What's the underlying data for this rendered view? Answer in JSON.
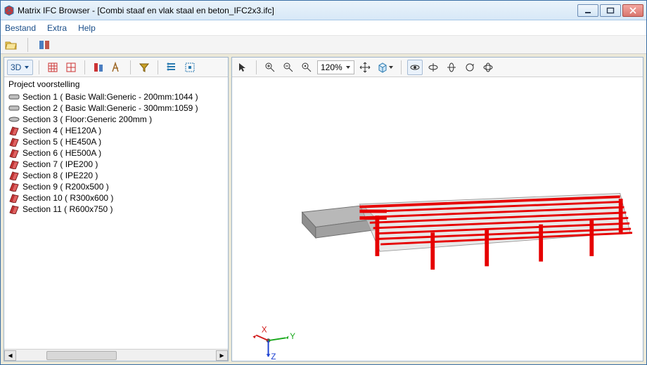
{
  "window": {
    "title": "Matrix IFC Browser - [Combi staaf en vlak staal en beton_IFC2x3.ifc]"
  },
  "menubar": {
    "items": [
      "Bestand",
      "Extra",
      "Help"
    ]
  },
  "left": {
    "view_mode": "3D",
    "tree_header": "Project voorstelling",
    "items": [
      {
        "type": "wall",
        "label": "Section 1 ( Basic Wall:Generic - 200mm:1044 )"
      },
      {
        "type": "wall",
        "label": "Section 2 ( Basic Wall:Generic - 300mm:1059 )"
      },
      {
        "type": "floor",
        "label": "Section 3 ( Floor:Generic 200mm )"
      },
      {
        "type": "beam",
        "label": "Section 4 ( HE120A )"
      },
      {
        "type": "beam",
        "label": "Section 5 ( HE450A )"
      },
      {
        "type": "beam",
        "label": "Section 6 ( HE500A )"
      },
      {
        "type": "beam",
        "label": "Section 7 ( IPE200 )"
      },
      {
        "type": "beam",
        "label": "Section 8 ( IPE220 )"
      },
      {
        "type": "beam",
        "label": "Section 9 ( R200x500 )"
      },
      {
        "type": "beam",
        "label": "Section 10 ( R300x600 )"
      },
      {
        "type": "beam",
        "label": "Section 11 ( R600x750 )"
      }
    ]
  },
  "viewer": {
    "zoom": "120%",
    "axes": {
      "x": "X",
      "y": "Y",
      "z": "Z"
    }
  },
  "colors": {
    "steel": "#e60000",
    "concrete": "#9a9a9a",
    "axis_x": "#d11a1a",
    "axis_y": "#17a81a",
    "axis_z": "#1a3fd1"
  }
}
